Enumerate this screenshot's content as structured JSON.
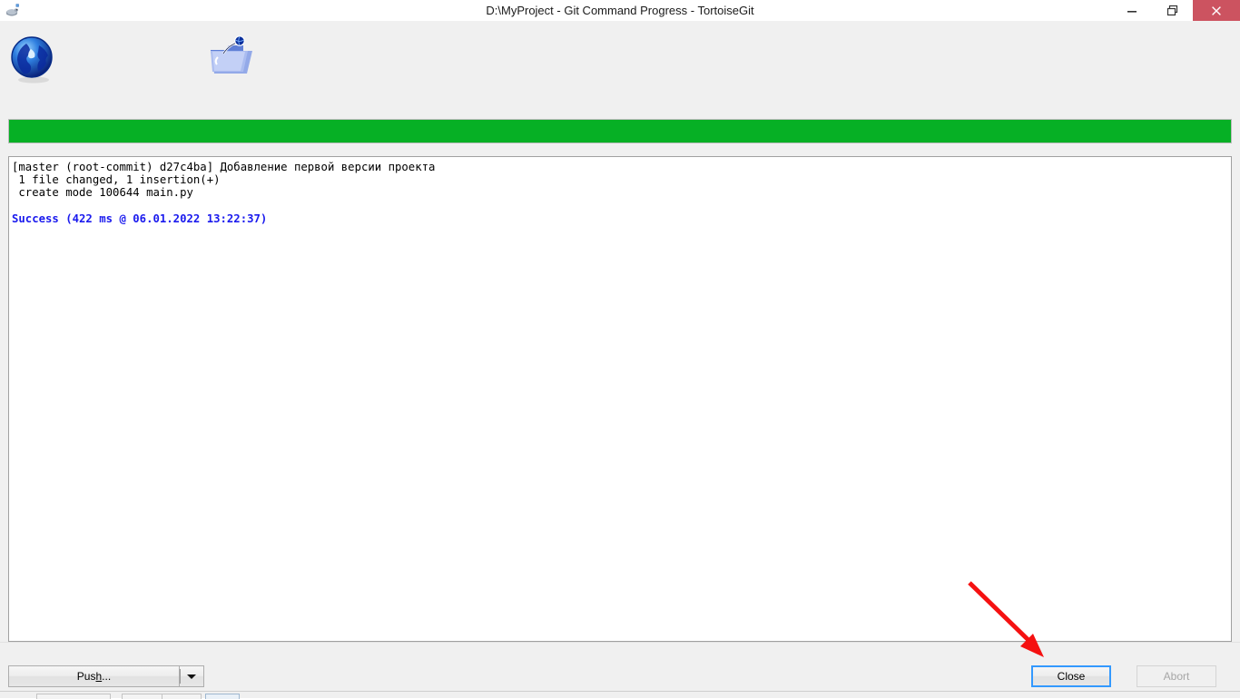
{
  "window": {
    "title": "D:\\MyProject - Git Command Progress - TortoiseGit",
    "app_icon": "tortoise-git-icon",
    "controls": {
      "minimize": "minimize-icon",
      "maximize": "restore-icon",
      "close": "close-icon",
      "close_color": "#cc5360"
    }
  },
  "toolbar": {
    "icons": [
      {
        "name": "globe-icon",
        "label": "Globe"
      },
      {
        "name": "folder-globe-icon",
        "label": "Folder"
      }
    ]
  },
  "progress": {
    "percent": 100,
    "color": "#06b025",
    "track_color": "#e6e6e6"
  },
  "log": {
    "lines": [
      {
        "text": "[master (root-commit) d27c4ba] Добавление первой версии проекта",
        "style": "normal"
      },
      {
        "text": " 1 file changed, 1 insertion(+)",
        "style": "normal"
      },
      {
        "text": " create mode 100644 main.py",
        "style": "normal"
      },
      {
        "text": "",
        "style": "blank"
      },
      {
        "text": "Success (422 ms @ 06.01.2022 13:22:37)",
        "style": "success"
      }
    ],
    "success_color": "#1a1aee"
  },
  "buttons": {
    "push": {
      "label_before": "Pus",
      "accel": "h",
      "label_after": "...",
      "full": "Push...",
      "dropdown": "chevron-down-icon"
    },
    "close": {
      "label": "Close",
      "default": true
    },
    "abort": {
      "label": "Abort",
      "disabled": true
    }
  },
  "annotation": {
    "type": "arrow",
    "color": "#f51111",
    "points_to": "close-button"
  }
}
